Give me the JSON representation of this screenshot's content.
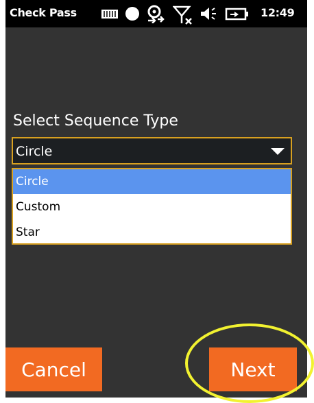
{
  "statusbar": {
    "app_title": "Check Pass",
    "time": "12:49",
    "icons": [
      "keyboard-icon",
      "record-dot-icon",
      "network-sync-icon",
      "no-signal-icon",
      "speaker-icon",
      "battery-icon"
    ]
  },
  "form": {
    "prompt": "Select Sequence Type",
    "selected_value": "Circle",
    "options": [
      "Circle",
      "Custom",
      "Star"
    ]
  },
  "buttons": {
    "cancel": "Cancel",
    "next": "Next"
  },
  "colors": {
    "screen_bg": "#333333",
    "accent_orange": "#f26a22",
    "select_border": "#d8a020",
    "selected_option": "#5b94ee",
    "highlight": "#f2f230"
  }
}
